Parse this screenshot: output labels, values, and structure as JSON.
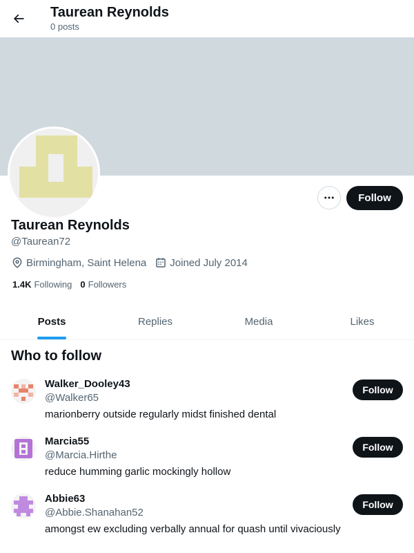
{
  "header": {
    "back_icon": "arrow-left-icon",
    "name": "Taurean Reynolds",
    "posts_count": "0 posts"
  },
  "colors": {
    "banner": "#cfd9de",
    "accent": "#1d9bf0",
    "button_dark": "#0f1419",
    "avatar_main": "#e3e0a4"
  },
  "profile": {
    "name": "Taurean Reynolds",
    "handle": "@Taurean72",
    "location": "Birmingham, Saint Helena",
    "joined": "Joined July 2014",
    "following_count": "1.4K",
    "following_label": "Following",
    "followers_count": "0",
    "followers_label": "Followers",
    "follow_label": "Follow",
    "more_icon": "ellipsis-icon"
  },
  "tabs": [
    {
      "label": "Posts",
      "active": true
    },
    {
      "label": "Replies",
      "active": false
    },
    {
      "label": "Media",
      "active": false
    },
    {
      "label": "Likes",
      "active": false
    }
  ],
  "who_to_follow": {
    "title": "Who to follow",
    "items": [
      {
        "name": "Walker_Dooley43",
        "handle": "@Walker65",
        "bio": "marionberry outside regularly midst finished dental",
        "follow_label": "Follow",
        "avatar_color": "#e8836e"
      },
      {
        "name": "Marcia55",
        "handle": "@Marcia.Hirthe",
        "bio": "reduce humming garlic mockingly hollow",
        "follow_label": "Follow",
        "avatar_color": "#b374d6"
      },
      {
        "name": "Abbie63",
        "handle": "@Abbie.Shanahan52",
        "bio": "amongst ew excluding verbally annual for quash until vivaciously",
        "follow_label": "Follow",
        "avatar_color": "#c08ae0"
      }
    ]
  }
}
